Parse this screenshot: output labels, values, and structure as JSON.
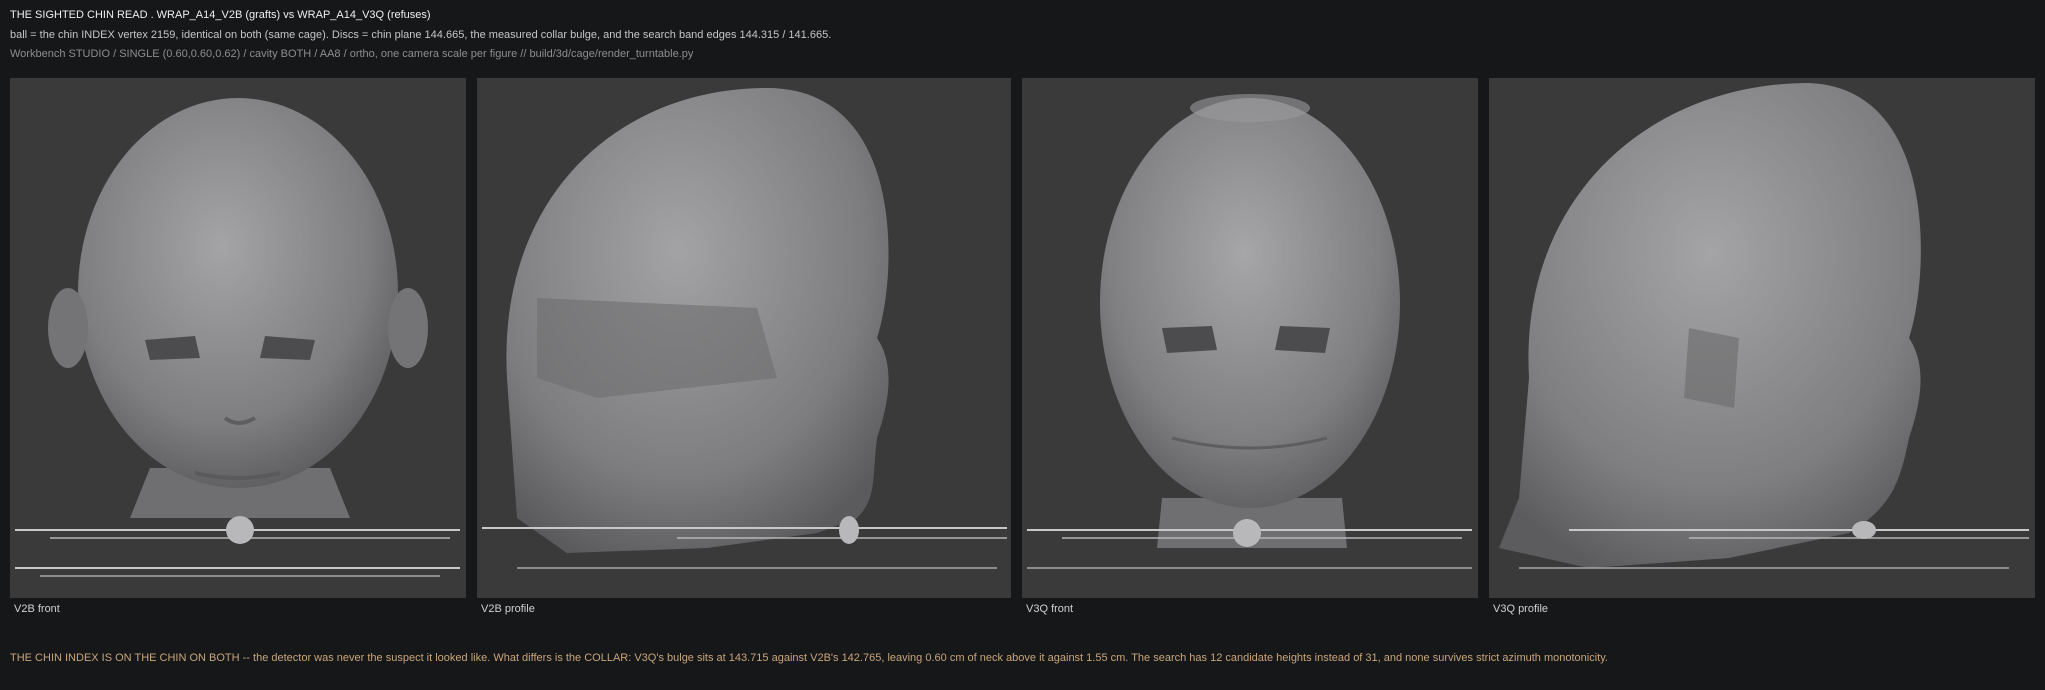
{
  "header": {
    "title": "THE SIGHTED CHIN READ . WRAP_A14_V2B (grafts) vs WRAP_A14_V3Q (refuses)",
    "subtitle": "ball = the chin INDEX vertex 2159, identical on both (same cage). Discs = chin plane 144.665, the measured collar bulge, and the search band edges 144.315 / 141.665.",
    "meta": "Workbench STUDIO / SINGLE (0.60,0.60,0.62) / cavity BOTH / AA8 / ortho, one camera scale per figure // build/3d/cage/render_turntable.py"
  },
  "panels": [
    {
      "caption": "V2B front"
    },
    {
      "caption": "V2B profile"
    },
    {
      "caption": "V3Q front"
    },
    {
      "caption": "V3Q profile"
    }
  ],
  "footer": "THE CHIN INDEX IS ON THE CHIN ON BOTH -- the detector was never the suspect it looked like. What differs is the COLLAR: V3Q's bulge sits at 143.715 against V2B's 142.765, leaving 0.60 cm of neck above it against 1.55 cm. The search has 12 candidate heights instead of 31, and none survives strict azimuth monotonicity.",
  "colors": {
    "background": "#161719",
    "panel": "#3a3a3b",
    "mesh": "#8d8d8f",
    "footer_text": "#c9a57a"
  }
}
